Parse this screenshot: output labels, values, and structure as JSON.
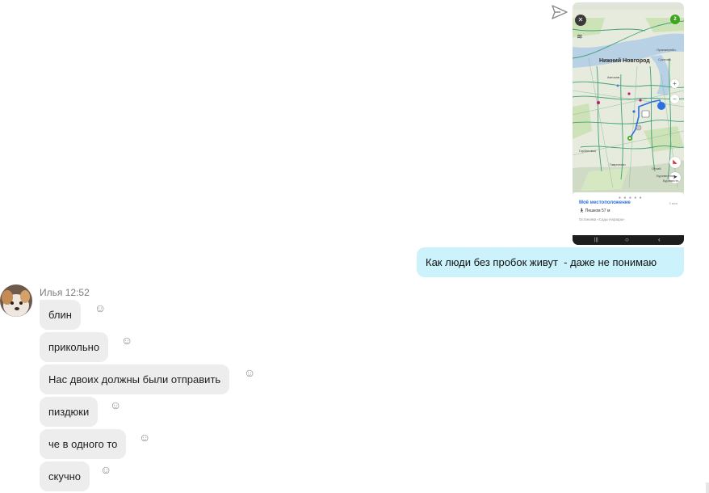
{
  "outgoing": {
    "send_icon": "send-arrow-icon",
    "image": {
      "close_glyph": "✕",
      "badge": "2",
      "layers_icon": "layers-icon",
      "city": "Нижний Новгород",
      "zoom_in": "+",
      "zoom_out": "−",
      "compass_icon": "compass-icon",
      "locate_icon": "locate-arrow-icon",
      "map_labels": [
        "Автозав.",
        "Горбатовка",
        "Гаврилово",
        "Буревестник",
        "Отчий",
        "Суслова",
        "Буревестн.",
        "Оранжерейн."
      ],
      "pager_dots": "● ● ● ● ●",
      "sheet_title": "Моё местоположение",
      "sheet_time": "3 мин",
      "sheet_walk": "Пешком 57 м",
      "sheet_stop": "Остановка «Сады Нарзара»",
      "nav_recent": "|||",
      "nav_home": "○",
      "nav_back": "‹",
      "route_color": "#2c6fe0",
      "green_color": "#3fa51f"
    },
    "message": "Как люди без пробок живут  - даже не понимаю"
  },
  "incoming": {
    "sender": "Илья",
    "time": "12:52",
    "react_glyph": "☺",
    "messages": [
      {
        "text": "блин"
      },
      {
        "text": "прикольно"
      },
      {
        "text": "Нас двоих должны были отправить"
      },
      {
        "text": "пиздюки"
      },
      {
        "text": "че в одного то"
      },
      {
        "text": "скучно"
      }
    ]
  }
}
